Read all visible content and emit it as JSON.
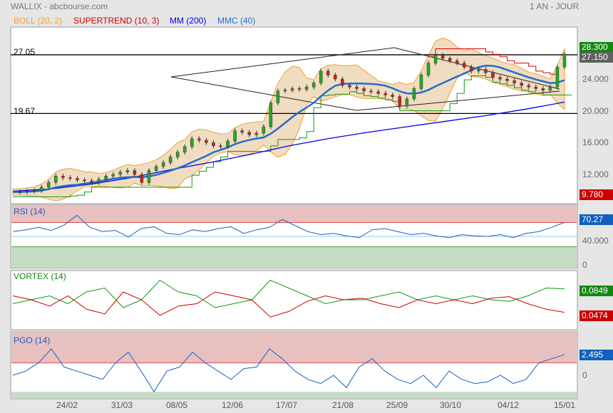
{
  "header": {
    "title": "WALLIX - abcbourse.com",
    "period": "1 AN - JOUR"
  },
  "legend": [
    {
      "label": "BOLL (20, 2)",
      "color": "#f4a030"
    },
    {
      "label": "SUPERTREND (10, 3)",
      "color": "#cc0000"
    },
    {
      "label": "MM (200)",
      "color": "#0000ee"
    },
    {
      "label": "MMC (40)",
      "color": "#1e6fd0"
    }
  ],
  "chart_data": {
    "type": "line",
    "title": "WALLIX",
    "x_ticks": [
      "24/02",
      "31/03",
      "08/05",
      "12/06",
      "17/07",
      "21/08",
      "25/09",
      "30/10",
      "04/12",
      "15/01"
    ],
    "price": {
      "ylim": [
        9,
        29.5
      ],
      "ticks": [
        "24.000",
        "20.000",
        "16.000",
        "12.000"
      ],
      "close": [
        9.8,
        9.8,
        9.9,
        10.0,
        10.4,
        11.0,
        11.8,
        11.6,
        11.5,
        11.3,
        11.2,
        11.0,
        11.4,
        11.8,
        12.0,
        12.3,
        12.5,
        12.0,
        11.0,
        12.5,
        13.0,
        13.5,
        14.2,
        14.8,
        15.5,
        16.5,
        16.3,
        16.0,
        15.6,
        15.5,
        16.2,
        17.5,
        17.3,
        17.0,
        17.2,
        18.0,
        21.0,
        22.5,
        22.6,
        22.8,
        22.7,
        23.0,
        23.5,
        25.0,
        24.5,
        24.0,
        23.2,
        23.0,
        22.8,
        22.5,
        22.4,
        22.2,
        22.0,
        21.8,
        20.6,
        21.5,
        22.8,
        24.5,
        26.0,
        27.0,
        26.6,
        26.3,
        26.0,
        25.5,
        25.0,
        25.2,
        24.8,
        24.2,
        24.0,
        23.8,
        23.5,
        23.2,
        23.0,
        22.8,
        22.6,
        23.0,
        25.5,
        27.15
      ],
      "mm200": [
        9.9,
        10.2,
        10.8,
        11.6,
        12.6,
        13.5,
        14.5,
        15.6,
        16.5,
        17.3,
        18.0,
        18.7,
        19.4,
        20.2,
        21.1
      ],
      "hlines": [
        {
          "label": "27.05",
          "value": 27.05
        },
        {
          "label": "19.67",
          "value": 19.67
        }
      ],
      "badges": {
        "high": "28.300",
        "last": "27.150",
        "low": "9.780"
      }
    },
    "rsi": {
      "title": "RSI (14)",
      "ticks": [
        "40.000",
        "0"
      ],
      "badge": "70.27",
      "upper": 70,
      "lower": 30,
      "mid": 47,
      "values": [
        55,
        58,
        62,
        57,
        66,
        82,
        62,
        55,
        57,
        46,
        60,
        63,
        52,
        50,
        58,
        55,
        60,
        63,
        52,
        58,
        62,
        75,
        65,
        55,
        50,
        52,
        48,
        45,
        58,
        60,
        55,
        50,
        52,
        48,
        45,
        50,
        48,
        47,
        50,
        45,
        52,
        55,
        62,
        70.27
      ]
    },
    "vortex": {
      "title": "VORTEX (14)",
      "plus_badge": "0.0849",
      "minus_badge": "0.0474",
      "plus": [
        0.95,
        1.0,
        1.05,
        0.95,
        1.1,
        1.15,
        0.9,
        1.0,
        1.25,
        1.1,
        1.05,
        0.9,
        0.95,
        1.0,
        1.25,
        1.15,
        1.05,
        0.95,
        1.0,
        1.0,
        1.05,
        1.1,
        1.0,
        1.05,
        1.0,
        1.05,
        1.0,
        0.98,
        1.05,
        1.15,
        1.14
      ],
      "minus": [
        1.05,
        1.0,
        0.92,
        1.05,
        0.88,
        0.82,
        1.1,
        1.0,
        0.8,
        0.92,
        0.95,
        1.1,
        1.05,
        1.0,
        0.78,
        0.85,
        0.98,
        1.05,
        1.0,
        1.02,
        0.95,
        0.9,
        1.0,
        0.95,
        1.0,
        0.95,
        1.02,
        1.04,
        0.95,
        0.88,
        0.84
      ]
    },
    "pgo": {
      "title": "PGO (14)",
      "ticks": [
        "0"
      ],
      "badge": "2.495",
      "upper": 1.5,
      "lower": -2,
      "values": [
        0,
        0.5,
        1.5,
        3.2,
        1.0,
        0.5,
        0,
        -0.5,
        1.5,
        2.8,
        0.5,
        -2.0,
        0.5,
        1.0,
        2.8,
        1.5,
        0.5,
        -0.5,
        0.8,
        1.0,
        3.2,
        2.0,
        0.5,
        -0.5,
        -1.0,
        0,
        -1.5,
        1.0,
        2.0,
        0.5,
        -0.5,
        -1.0,
        0,
        -1.5,
        0.5,
        -0.5,
        -1.0,
        -0.8,
        0,
        -1.0,
        -0.5,
        1.5,
        2.0,
        2.495
      ]
    }
  }
}
